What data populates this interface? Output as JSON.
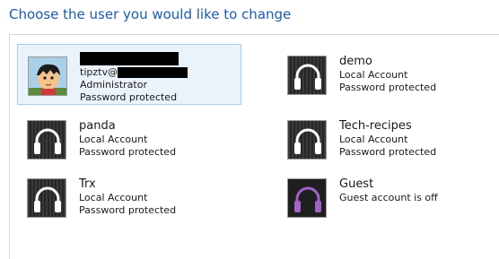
{
  "heading": "Choose the user you would like to change",
  "accounts": [
    {
      "name": "",
      "email_prefix": "tipztv@",
      "type": "Administrator",
      "status": "Password protected",
      "icon": "user-avatar-icon"
    },
    {
      "name": "demo",
      "type": "Local Account",
      "status": "Password protected",
      "icon": "headphones-icon"
    },
    {
      "name": "panda",
      "type": "Local Account",
      "status": "Password protected",
      "icon": "headphones-icon"
    },
    {
      "name": "Tech-recipes",
      "type": "Local Account",
      "status": "Password protected",
      "icon": "headphones-icon"
    },
    {
      "name": "Trx",
      "type": "Local Account",
      "status": "Password protected",
      "icon": "headphones-icon"
    },
    {
      "name": "Guest",
      "status": "Guest account is off",
      "icon": "headphones-icon"
    }
  ],
  "colors": {
    "heading": "#1e5aa8",
    "selected_bg": "#eaf3fc",
    "selected_border": "#a8cbea",
    "headphones_white": "#ffffff",
    "headphones_guest": "#a063c8"
  }
}
